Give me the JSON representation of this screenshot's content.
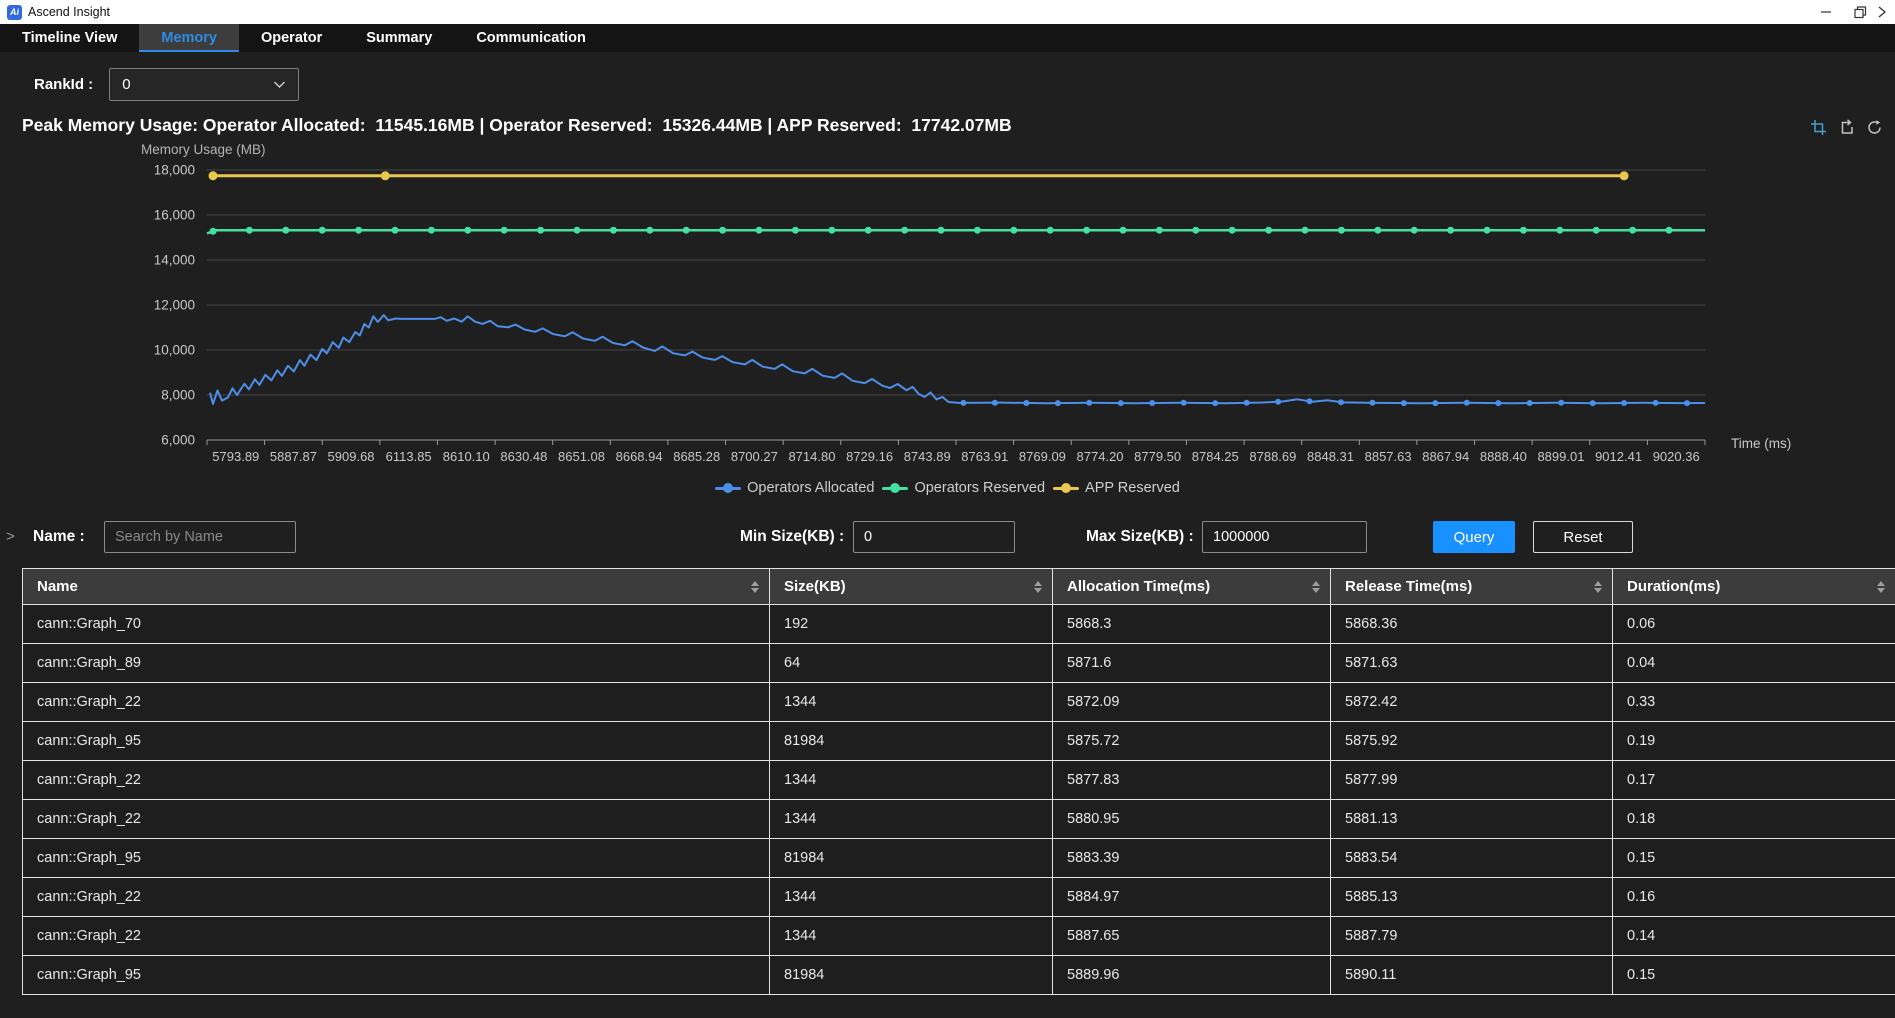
{
  "titlebar": {
    "app_name": "Ascend Insight"
  },
  "tabs": [
    {
      "label": "Timeline View",
      "active": false
    },
    {
      "label": "Memory",
      "active": true
    },
    {
      "label": "Operator",
      "active": false
    },
    {
      "label": "Summary",
      "active": false
    },
    {
      "label": "Communication",
      "active": false
    }
  ],
  "rank": {
    "label": "RankId :",
    "value": "0"
  },
  "peak_summary": "Peak Memory Usage: Operator Allocated:  11545.16MB | Operator Reserved:  15326.44MB | APP Reserved:  17742.07MB",
  "toolbox": {
    "icons": [
      "zoom-select-icon",
      "zoom-back-icon",
      "restore-icon"
    ]
  },
  "chart_data": {
    "type": "line",
    "title": "Memory Usage (MB)",
    "xlabel": "Time (ms)",
    "ylim": [
      6000,
      18000
    ],
    "yticks": [
      6000,
      8000,
      10000,
      12000,
      14000,
      16000,
      18000
    ],
    "grid": true,
    "legend_position": "bottom",
    "x_ticks": [
      "5793.89",
      "5887.87",
      "5909.68",
      "6113.85",
      "8610.10",
      "8630.48",
      "8651.08",
      "8668.94",
      "8685.28",
      "8700.27",
      "8714.80",
      "8729.16",
      "8743.89",
      "8763.91",
      "8769.09",
      "8774.20",
      "8779.50",
      "8784.25",
      "8788.69",
      "8848.31",
      "8857.63",
      "8867.94",
      "8888.40",
      "8899.01",
      "9012.41",
      "9020.36"
    ],
    "series": [
      {
        "name": "Operators Allocated",
        "color": "#4d8fe8",
        "width": 2,
        "marker_r": 3,
        "marker_spec": {
          "from": 0.505,
          "to": 1.0,
          "step": 0.021
        },
        "points": [
          [
            0.002,
            8100
          ],
          [
            0.004,
            7600
          ],
          [
            0.007,
            8200
          ],
          [
            0.01,
            7750
          ],
          [
            0.014,
            7900
          ],
          [
            0.017,
            8300
          ],
          [
            0.02,
            8000
          ],
          [
            0.025,
            8500
          ],
          [
            0.028,
            8250
          ],
          [
            0.032,
            8700
          ],
          [
            0.035,
            8450
          ],
          [
            0.039,
            8900
          ],
          [
            0.043,
            8650
          ],
          [
            0.047,
            9100
          ],
          [
            0.05,
            8850
          ],
          [
            0.054,
            9300
          ],
          [
            0.058,
            9050
          ],
          [
            0.062,
            9550
          ],
          [
            0.065,
            9300
          ],
          [
            0.069,
            9800
          ],
          [
            0.073,
            9550
          ],
          [
            0.077,
            10050
          ],
          [
            0.08,
            9850
          ],
          [
            0.084,
            10350
          ],
          [
            0.088,
            10100
          ],
          [
            0.091,
            10550
          ],
          [
            0.095,
            10350
          ],
          [
            0.099,
            10800
          ],
          [
            0.102,
            10650
          ],
          [
            0.105,
            11150
          ],
          [
            0.108,
            11000
          ],
          [
            0.111,
            11500
          ],
          [
            0.114,
            11250
          ],
          [
            0.118,
            11550
          ],
          [
            0.121,
            11320
          ],
          [
            0.126,
            11400
          ],
          [
            0.13,
            11380
          ],
          [
            0.152,
            11380
          ],
          [
            0.156,
            11460
          ],
          [
            0.16,
            11300
          ],
          [
            0.165,
            11400
          ],
          [
            0.17,
            11260
          ],
          [
            0.174,
            11500
          ],
          [
            0.179,
            11260
          ],
          [
            0.184,
            11160
          ],
          [
            0.189,
            11300
          ],
          [
            0.194,
            11060
          ],
          [
            0.201,
            11010
          ],
          [
            0.206,
            11130
          ],
          [
            0.212,
            10910
          ],
          [
            0.219,
            10810
          ],
          [
            0.224,
            10960
          ],
          [
            0.231,
            10710
          ],
          [
            0.239,
            10610
          ],
          [
            0.244,
            10790
          ],
          [
            0.251,
            10510
          ],
          [
            0.259,
            10410
          ],
          [
            0.264,
            10590
          ],
          [
            0.271,
            10310
          ],
          [
            0.279,
            10210
          ],
          [
            0.284,
            10390
          ],
          [
            0.291,
            10110
          ],
          [
            0.299,
            9960
          ],
          [
            0.304,
            10160
          ],
          [
            0.311,
            9860
          ],
          [
            0.319,
            9760
          ],
          [
            0.324,
            9930
          ],
          [
            0.331,
            9660
          ],
          [
            0.339,
            9560
          ],
          [
            0.344,
            9730
          ],
          [
            0.351,
            9460
          ],
          [
            0.359,
            9360
          ],
          [
            0.364,
            9560
          ],
          [
            0.371,
            9260
          ],
          [
            0.379,
            9160
          ],
          [
            0.384,
            9360
          ],
          [
            0.391,
            9060
          ],
          [
            0.399,
            8960
          ],
          [
            0.404,
            9160
          ],
          [
            0.411,
            8860
          ],
          [
            0.419,
            8760
          ],
          [
            0.424,
            8960
          ],
          [
            0.431,
            8630
          ],
          [
            0.439,
            8530
          ],
          [
            0.444,
            8710
          ],
          [
            0.451,
            8410
          ],
          [
            0.456,
            8310
          ],
          [
            0.461,
            8490
          ],
          [
            0.467,
            8210
          ],
          [
            0.471,
            8360
          ],
          [
            0.475,
            8060
          ],
          [
            0.479,
            7910
          ],
          [
            0.483,
            8110
          ],
          [
            0.487,
            7810
          ],
          [
            0.491,
            7910
          ],
          [
            0.495,
            7690
          ],
          [
            0.502,
            7650
          ],
          [
            0.53,
            7660
          ],
          [
            0.56,
            7635
          ],
          [
            0.59,
            7655
          ],
          [
            0.62,
            7635
          ],
          [
            0.65,
            7655
          ],
          [
            0.68,
            7635
          ],
          [
            0.705,
            7665
          ],
          [
            0.718,
            7710
          ],
          [
            0.728,
            7810
          ],
          [
            0.738,
            7700
          ],
          [
            0.748,
            7770
          ],
          [
            0.758,
            7670
          ],
          [
            0.78,
            7650
          ],
          [
            0.81,
            7635
          ],
          [
            0.84,
            7655
          ],
          [
            0.87,
            7635
          ],
          [
            0.9,
            7655
          ],
          [
            0.93,
            7635
          ],
          [
            0.96,
            7655
          ],
          [
            0.985,
            7640
          ],
          [
            1.0,
            7645
          ]
        ]
      },
      {
        "name": "Operators Reserved",
        "color": "#43e0a2",
        "width": 2.5,
        "marker_r": 3.5,
        "marker_spec": {
          "from": 0.004,
          "to": 1.0,
          "step": 0.0243
        },
        "points": [
          [
            0.0,
            15180
          ],
          [
            0.006,
            15326.44
          ],
          [
            1.0,
            15326.44
          ]
        ]
      },
      {
        "name": "APP Reserved",
        "color": "#e8c84d",
        "width": 3,
        "marker_r": 4.5,
        "marker_fracs": [
          0.004,
          0.119,
          0.946
        ],
        "points": [
          [
            0.002,
            17742.07
          ],
          [
            0.948,
            17742.07
          ]
        ]
      }
    ]
  },
  "filters": {
    "name_label": "Name :",
    "name_placeholder": "Search by Name",
    "min_label": "Min Size(KB) :",
    "min_value": "0",
    "max_label": "Max Size(KB) :",
    "max_value": "1000000",
    "query_label": "Query",
    "reset_label": "Reset"
  },
  "table": {
    "columns": [
      "Name",
      "Size(KB)",
      "Allocation Time(ms)",
      "Release Time(ms)",
      "Duration(ms)"
    ],
    "rows": [
      [
        "cann::Graph_70",
        "192",
        "5868.3",
        "5868.36",
        "0.06"
      ],
      [
        "cann::Graph_89",
        "64",
        "5871.6",
        "5871.63",
        "0.04"
      ],
      [
        "cann::Graph_22",
        "1344",
        "5872.09",
        "5872.42",
        "0.33"
      ],
      [
        "cann::Graph_95",
        "81984",
        "5875.72",
        "5875.92",
        "0.19"
      ],
      [
        "cann::Graph_22",
        "1344",
        "5877.83",
        "5877.99",
        "0.17"
      ],
      [
        "cann::Graph_22",
        "1344",
        "5880.95",
        "5881.13",
        "0.18"
      ],
      [
        "cann::Graph_95",
        "81984",
        "5883.39",
        "5883.54",
        "0.15"
      ],
      [
        "cann::Graph_22",
        "1344",
        "5884.97",
        "5885.13",
        "0.16"
      ],
      [
        "cann::Graph_22",
        "1344",
        "5887.65",
        "5887.79",
        "0.14"
      ],
      [
        "cann::Graph_95",
        "81984",
        "5889.96",
        "5890.11",
        "0.15"
      ]
    ]
  },
  "colors": {
    "accent_blue": "#2f8be5",
    "button_blue": "#1890ff",
    "series_allocated": "#4d8fe8",
    "series_reserved": "#43e0a2",
    "series_app": "#e8c84d",
    "titlebar_bg": "#ffffff",
    "panel_bg": "#1f1f1f",
    "table_header_bg": "#3c3c3c"
  }
}
